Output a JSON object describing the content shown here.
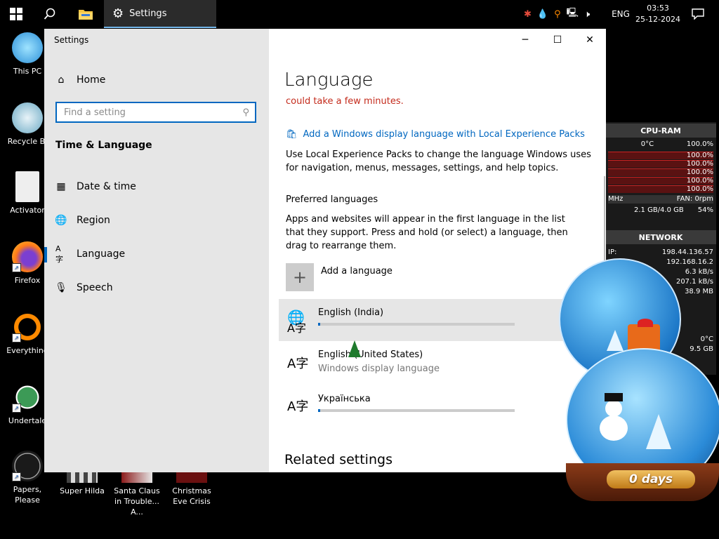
{
  "taskbar": {
    "active_app": "Settings",
    "language": "ENG",
    "time": "03:53",
    "date": "25-12-2024"
  },
  "desktop": {
    "icons": [
      {
        "label": "This PC",
        "icon": "monitor-icon"
      },
      {
        "label": "Recycle Bi",
        "icon": "recycle-bin-icon"
      },
      {
        "label": "Activator",
        "icon": "document-icon"
      },
      {
        "label": "Firefox",
        "icon": "firefox-icon"
      },
      {
        "label": "Everything",
        "icon": "magnifier-icon"
      },
      {
        "label": "Undertale",
        "icon": "undertale-icon"
      },
      {
        "label": "Papers, Please",
        "icon": "papers-please-icon"
      },
      {
        "label": "Super Hilda",
        "icon": "game-icon"
      },
      {
        "label": "Santa Claus in Trouble... A...",
        "icon": "game-icon"
      },
      {
        "label": "Christmas Eve Crisis",
        "icon": "game-icon"
      }
    ]
  },
  "window": {
    "title": "Settings",
    "sidebar": {
      "home": "Home",
      "search_placeholder": "Find a setting",
      "section": "Time & Language",
      "items": [
        {
          "label": "Date & time",
          "icon": "calendar-clock-icon"
        },
        {
          "label": "Region",
          "icon": "globe-icon"
        },
        {
          "label": "Language",
          "icon": "language-icon",
          "selected": true
        },
        {
          "label": "Speech",
          "icon": "microphone-icon"
        }
      ]
    },
    "content": {
      "title": "Language",
      "warning": "could take a few minutes.",
      "lxp_link": "Add a Windows display language with Local Experience Packs",
      "lxp_desc": "Use Local Experience Packs to change the language Windows uses for navigation, menus, messages, settings, and help topics.",
      "preferred_head": "Preferred languages",
      "preferred_desc": "Apps and websites will appear in the first language in the list that they support. Press and hold (or select) a language, then drag to rearrange them.",
      "add_language": "Add a language",
      "languages": [
        {
          "name": "English (India)",
          "sub": "",
          "progress": 0.01
        },
        {
          "name": "English (United States)",
          "sub": "Windows display language"
        },
        {
          "name": "Українська",
          "sub": "",
          "progress": 0.01
        }
      ],
      "related": "Related settings"
    }
  },
  "gadget": {
    "cpu_head": "CPU-RAM",
    "cpu_temp": "0°C",
    "cpu_load": "100.0%",
    "cores": [
      "100.0%",
      "100.0%",
      "100.0%",
      "100.0%",
      "100.0%"
    ],
    "mhz": "MHz",
    "fan": "FAN: 0rpm",
    "ram": "2.1 GB/4.0 GB",
    "ram_pct": "54%",
    "net_head": "NETWORK",
    "ip_label": "IP:",
    "ip_ext": "198.44.136.57",
    "ip_int": "192.168.16.2",
    "down": "6.3 kB/s",
    "up": "207.1 kB/s",
    "total": "38.9 MB",
    "temp2": "0°C",
    "speed2": "9.5 GB"
  },
  "countdown": {
    "days_label": "0 days"
  }
}
